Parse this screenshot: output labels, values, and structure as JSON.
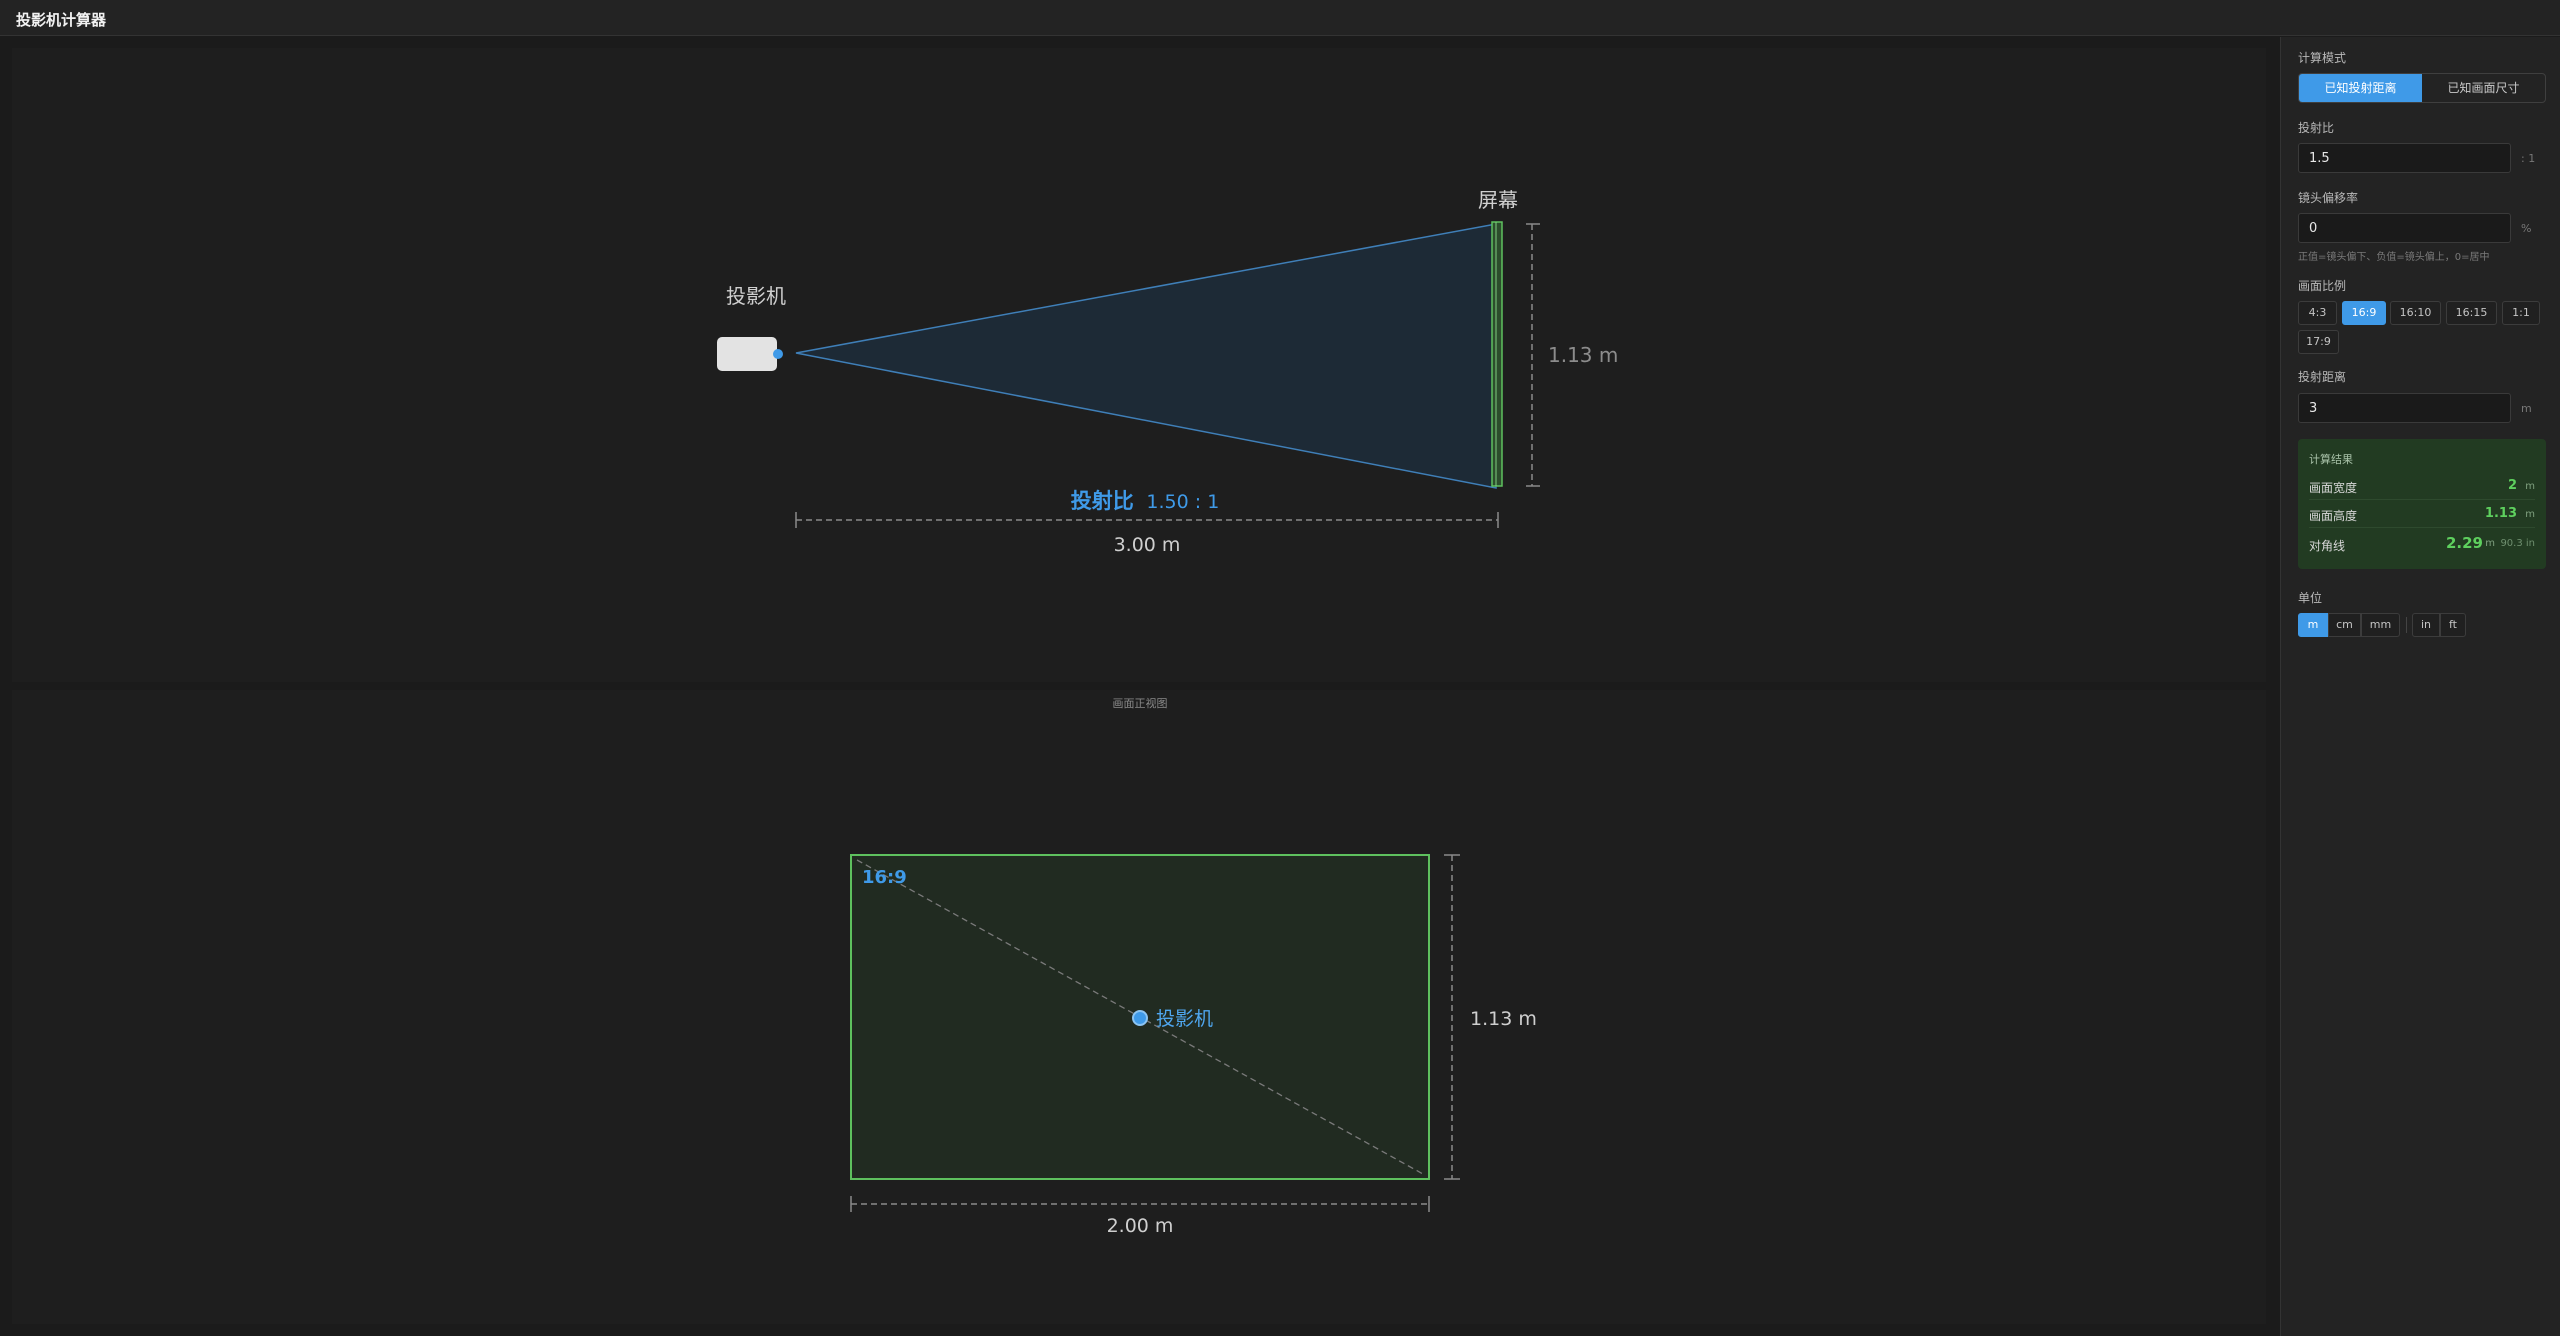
{
  "app": {
    "title": "投影机计算器"
  },
  "side_view": {
    "projector_label": "投影机",
    "screen_label": "屏幕",
    "height_dim": "1.13 m",
    "ratio_label": "投射比",
    "ratio_value": "1.50 : 1",
    "distance_dim": "3.00 m"
  },
  "front_view": {
    "caption": "画面正视图",
    "aspect_tag": "16:9",
    "projector_label": "投影机",
    "height_dim": "1.13 m",
    "width_dim": "2.00 m"
  },
  "panel": {
    "mode_label": "计算模式",
    "mode_options": [
      "已知投射距离",
      "已知画面尺寸"
    ],
    "mode_selected": "已知投射距离",
    "throw_ratio_label": "投射比",
    "throw_ratio_value": "1.5",
    "throw_ratio_unit": ": 1",
    "offset_label": "镜头偏移率",
    "offset_value": "0",
    "offset_unit": "%",
    "offset_hint": "正值=镜头偏下、负值=镜头偏上，0=居中",
    "aspect_label": "画面比例",
    "aspect_options": [
      "4:3",
      "16:9",
      "16:10",
      "16:15",
      "1:1",
      "17:9"
    ],
    "aspect_selected": "16:9",
    "distance_label": "投射距离",
    "distance_value": "3",
    "distance_unit": "m",
    "result": {
      "title": "计算结果",
      "width_label": "画面宽度",
      "width_value": "2",
      "width_unit": "m",
      "height_label": "画面高度",
      "height_value": "1.13",
      "height_unit": "m",
      "diag_label": "对角线",
      "diag_value": "2.29",
      "diag_unit": "m",
      "diag_inch": "90.3 in"
    },
    "units_label": "单位",
    "units_metric": [
      "m",
      "cm",
      "mm"
    ],
    "units_imperial": [
      "in",
      "ft"
    ],
    "unit_selected": "m"
  },
  "colors": {
    "accent": "#3f9ae8",
    "screen_green": "#5ec15e",
    "result_bg": "#223b22"
  }
}
